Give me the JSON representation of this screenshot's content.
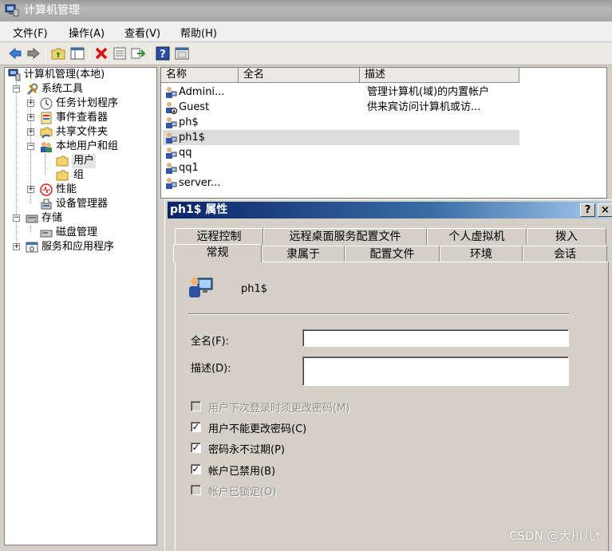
{
  "window": {
    "title": "计算机管理"
  },
  "menu": [
    "文件(F)",
    "操作(A)",
    "查看(V)",
    "帮助(H)"
  ],
  "toolbar": {
    "icons": [
      "back-icon",
      "forward-icon",
      "up-folder-icon",
      "show-hide-tree-icon",
      "delete-icon",
      "properties-icon",
      "export-icon",
      "help-icon",
      "view-icon"
    ]
  },
  "tree": {
    "root": "计算机管理(本地)",
    "system_tools": "系统工具",
    "task_scheduler": "任务计划程序",
    "event_viewer": "事件查看器",
    "shared_folders": "共享文件夹",
    "local_users_groups": "本地用户和组",
    "users": "用户",
    "groups": "组",
    "performance": "性能",
    "device_manager": "设备管理器",
    "storage": "存储",
    "disk_management": "磁盘管理",
    "services_apps": "服务和应用程序"
  },
  "list": {
    "columns": [
      "名称",
      "全名",
      "描述"
    ],
    "rows": [
      {
        "name": "Admini...",
        "desc": "管理计算机(域)的内置帐户"
      },
      {
        "name": "Guest",
        "desc": "供来宾访问计算机或访..."
      },
      {
        "name": "ph$",
        "desc": ""
      },
      {
        "name": "ph1$",
        "desc": ""
      },
      {
        "name": "qq",
        "desc": ""
      },
      {
        "name": "qq1",
        "desc": ""
      },
      {
        "name": "server...",
        "desc": ""
      }
    ]
  },
  "dialog": {
    "title": "ph1$ 属性",
    "help_btn": "?",
    "close_btn": "×",
    "tabs_back": [
      "远程控制",
      "远程桌面服务配置文件",
      "个人虚拟机",
      "拨入"
    ],
    "tabs_front": [
      "常规",
      "隶属于",
      "配置文件",
      "环境",
      "会话"
    ],
    "username": "ph1$",
    "fullname_label": "全名(F):",
    "fullname_value": "",
    "desc_label": "描述(D):",
    "desc_value": "",
    "checkboxes": [
      {
        "label": "用户下次登录时须更改密码(M)",
        "checked": false,
        "enabled": false
      },
      {
        "label": "用户不能更改密码(C)",
        "checked": true,
        "enabled": true
      },
      {
        "label": "密码永不过期(P)",
        "checked": true,
        "enabled": true
      },
      {
        "label": "帐户已禁用(B)",
        "checked": true,
        "enabled": true
      },
      {
        "label": "帐户已锁定(O)",
        "checked": false,
        "enabled": false
      }
    ]
  },
  "watermark": "CSDN @大川儿*"
}
